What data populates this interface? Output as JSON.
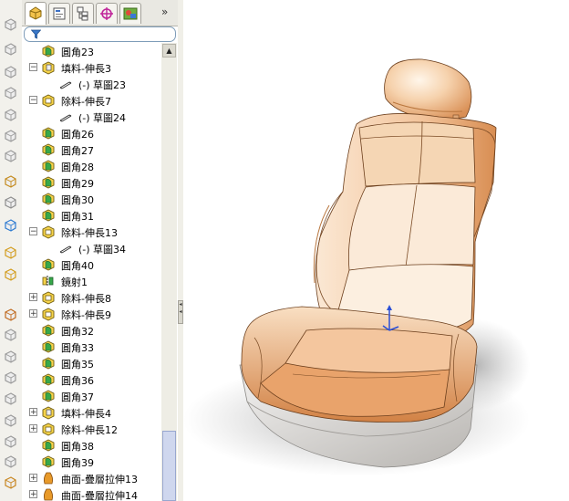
{
  "feature_tree": {
    "items": [
      {
        "label": "圓角23",
        "icon": "fillet-icon",
        "expander": ""
      },
      {
        "label": "填料-伸長3",
        "icon": "extrude-boss-icon",
        "expander": "−"
      },
      {
        "label": "(-) 草圖23",
        "icon": "sketch-icon",
        "expander": ""
      },
      {
        "label": "除料-伸長7",
        "icon": "extrude-cut-icon",
        "expander": "−"
      },
      {
        "label": "(-) 草圖24",
        "icon": "sketch-icon",
        "expander": ""
      },
      {
        "label": "圓角26",
        "icon": "fillet-icon",
        "expander": ""
      },
      {
        "label": "圓角27",
        "icon": "fillet-icon",
        "expander": ""
      },
      {
        "label": "圓角28",
        "icon": "fillet-icon",
        "expander": ""
      },
      {
        "label": "圓角29",
        "icon": "fillet-icon",
        "expander": ""
      },
      {
        "label": "圓角30",
        "icon": "fillet-icon",
        "expander": ""
      },
      {
        "label": "圓角31",
        "icon": "fillet-icon",
        "expander": ""
      },
      {
        "label": "除料-伸長13",
        "icon": "extrude-cut-icon",
        "expander": "−"
      },
      {
        "label": "(-) 草圖34",
        "icon": "sketch-icon",
        "expander": ""
      },
      {
        "label": "圓角40",
        "icon": "fillet-icon",
        "expander": ""
      },
      {
        "label": "鏡射1",
        "icon": "mirror-icon",
        "expander": ""
      },
      {
        "label": "除料-伸長8",
        "icon": "extrude-cut-icon",
        "expander": "+"
      },
      {
        "label": "除料-伸長9",
        "icon": "extrude-cut-icon",
        "expander": "+"
      },
      {
        "label": "圓角32",
        "icon": "fillet-icon",
        "expander": ""
      },
      {
        "label": "圓角33",
        "icon": "fillet-icon",
        "expander": ""
      },
      {
        "label": "圓角35",
        "icon": "fillet-icon",
        "expander": ""
      },
      {
        "label": "圓角36",
        "icon": "fillet-icon",
        "expander": ""
      },
      {
        "label": "圓角37",
        "icon": "fillet-icon",
        "expander": ""
      },
      {
        "label": "填料-伸長4",
        "icon": "extrude-boss-icon",
        "expander": "+"
      },
      {
        "label": "除料-伸長12",
        "icon": "extrude-cut-icon",
        "expander": "+"
      },
      {
        "label": "圓角38",
        "icon": "fillet-icon",
        "expander": ""
      },
      {
        "label": "圓角39",
        "icon": "fillet-icon",
        "expander": ""
      },
      {
        "label": "曲面-疊層拉伸13",
        "icon": "surface-loft-icon",
        "expander": "+"
      },
      {
        "label": "曲面-疊層拉伸14",
        "icon": "surface-loft-icon",
        "expander": "+"
      }
    ]
  },
  "tabs": [
    {
      "name": "featuremanager-tab"
    },
    {
      "name": "propertymanager-tab"
    },
    {
      "name": "configurationmanager-tab"
    },
    {
      "name": "dimxpert-tab"
    },
    {
      "name": "display-manager-tab"
    }
  ],
  "more_tabs": "»",
  "colors": {
    "panel_bg": "#e9e8e2",
    "seat_surface": "#f2c9a0",
    "seat_base": "#e4e2de"
  }
}
